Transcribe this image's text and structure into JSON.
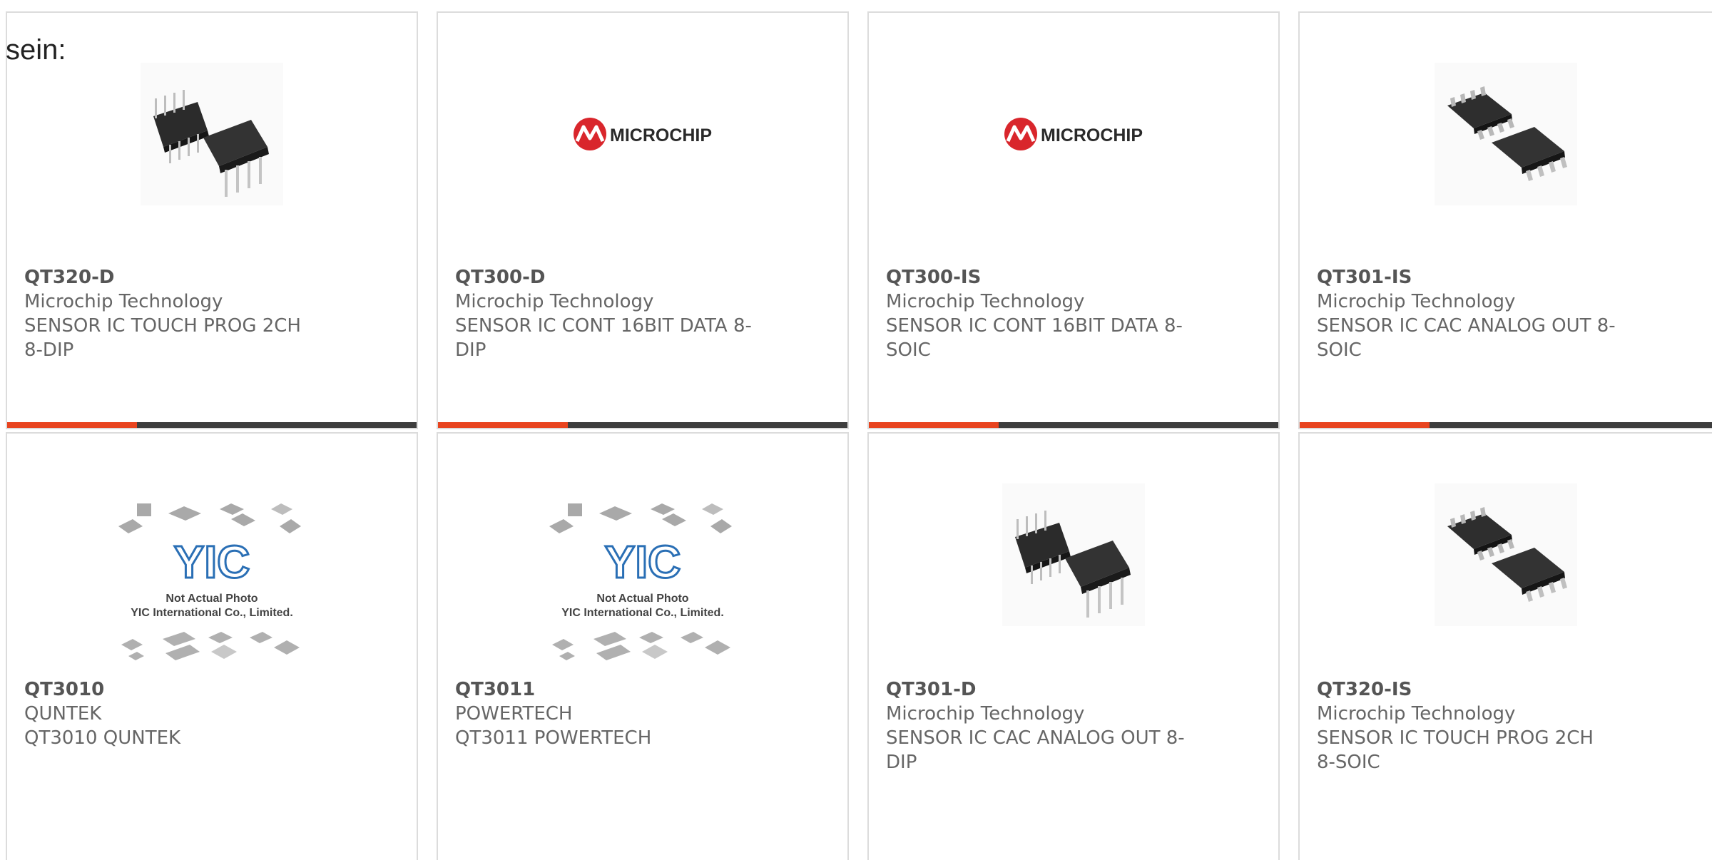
{
  "prefix_text": "sein:",
  "colors": {
    "accent": "#e8441f",
    "bar_dark": "#3d3d3d",
    "microchip_red": "#d9262c"
  },
  "products": [
    {
      "part_number": "QT320-D",
      "manufacturer": "Microchip Technology",
      "description": "SENSOR IC TOUCH PROG 2CH 8-DIP",
      "image": "dip-package-icon"
    },
    {
      "part_number": "QT300-D",
      "manufacturer": "Microchip Technology",
      "description": "SENSOR IC CONT 16BIT DATA 8-DIP",
      "image": "microchip-logo"
    },
    {
      "part_number": "QT300-IS",
      "manufacturer": "Microchip Technology",
      "description": "SENSOR IC CONT 16BIT DATA 8-SOIC",
      "image": "microchip-logo"
    },
    {
      "part_number": "QT301-IS",
      "manufacturer": "Microchip Technology",
      "description": "SENSOR IC CAC ANALOG OUT 8-SOIC",
      "image": "soic-package-icon"
    },
    {
      "part_number": "QT3010",
      "manufacturer": "QUNTEK",
      "description": "QT3010 QUNTEK",
      "image": "yic-placeholder"
    },
    {
      "part_number": "QT3011",
      "manufacturer": "POWERTECH",
      "description": "QT3011 POWERTECH",
      "image": "yic-placeholder"
    },
    {
      "part_number": "QT301-D",
      "manufacturer": "Microchip Technology",
      "description": "SENSOR IC CAC ANALOG OUT 8-DIP",
      "image": "dip-package-icon"
    },
    {
      "part_number": "QT320-IS",
      "manufacturer": "Microchip Technology",
      "description": "SENSOR IC TOUCH PROG 2CH 8-SOIC",
      "image": "soic-package-icon"
    }
  ],
  "logo_text": {
    "microchip": "MICROCHIP",
    "yic_mark": "YIC",
    "yic_line1": "Not Actual Photo",
    "yic_line2": "YIC International Co., Limited."
  }
}
